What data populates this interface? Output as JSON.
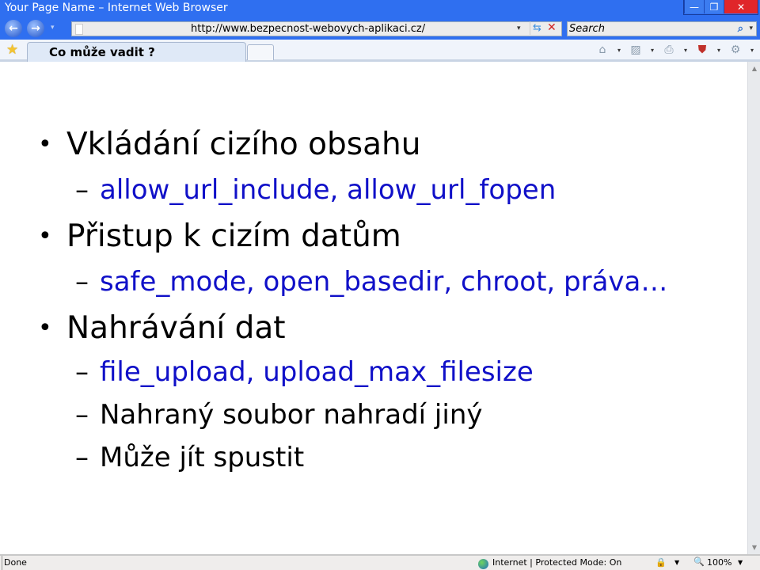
{
  "window": {
    "title": "Your Page Name – Internet Web Browser",
    "minimize_icon": "—",
    "restore_icon": "❐",
    "close_icon": "✕"
  },
  "nav": {
    "back_icon": "←",
    "forward_icon": "→",
    "dropdown_icon": "▾",
    "url": "http://www.bezpecnost-webovych-aplikaci.cz/",
    "refresh_icon": "⇆",
    "stop_icon": "✕",
    "search_placeholder": "Search",
    "search_icon": "⌕"
  },
  "tabs": {
    "favorites_icon": "★",
    "active_tab_label": "Co může vadit ?",
    "command_icons": [
      {
        "name": "home",
        "glyph": "⌂"
      },
      {
        "name": "feeds",
        "glyph": "▨"
      },
      {
        "name": "print",
        "glyph": "⎙"
      },
      {
        "name": "safety",
        "glyph": "⛊"
      },
      {
        "name": "tools",
        "glyph": "⚙"
      }
    ],
    "dropdown_glyph": "▾"
  },
  "slide": {
    "items": [
      {
        "level": 1,
        "text": "Vkládání cizího obsahu",
        "color": "#000000"
      },
      {
        "level": 2,
        "text": "allow_url_include, allow_url_fopen",
        "color": "#1010c8"
      },
      {
        "level": 1,
        "text": "Přistup k cizím datům",
        "color": "#000000"
      },
      {
        "level": 2,
        "text": "safe_mode, open_basedir, chroot, práva…",
        "color": "#1010c8"
      },
      {
        "level": 1,
        "text": "Nahrávání dat",
        "color": "#000000"
      },
      {
        "level": 2,
        "text": "file_upload, upload_max_filesize",
        "color": "#1010c8"
      },
      {
        "level": 2,
        "text": "Nahraný soubor nahradí jiný",
        "color": "#000000"
      },
      {
        "level": 2,
        "text": "Může jít spustit",
        "color": "#000000"
      }
    ],
    "bullet_glyph": "•",
    "dash_glyph": "–"
  },
  "scrollbar": {
    "up_icon": "▲",
    "down_icon": "▼"
  },
  "status": {
    "text": "Done",
    "zone": "Internet | Protected Mode: On",
    "lock_icon": "🔒",
    "zoom_icon": "🔍",
    "zoom_level": "100%",
    "dropdown_glyph": "▼"
  }
}
